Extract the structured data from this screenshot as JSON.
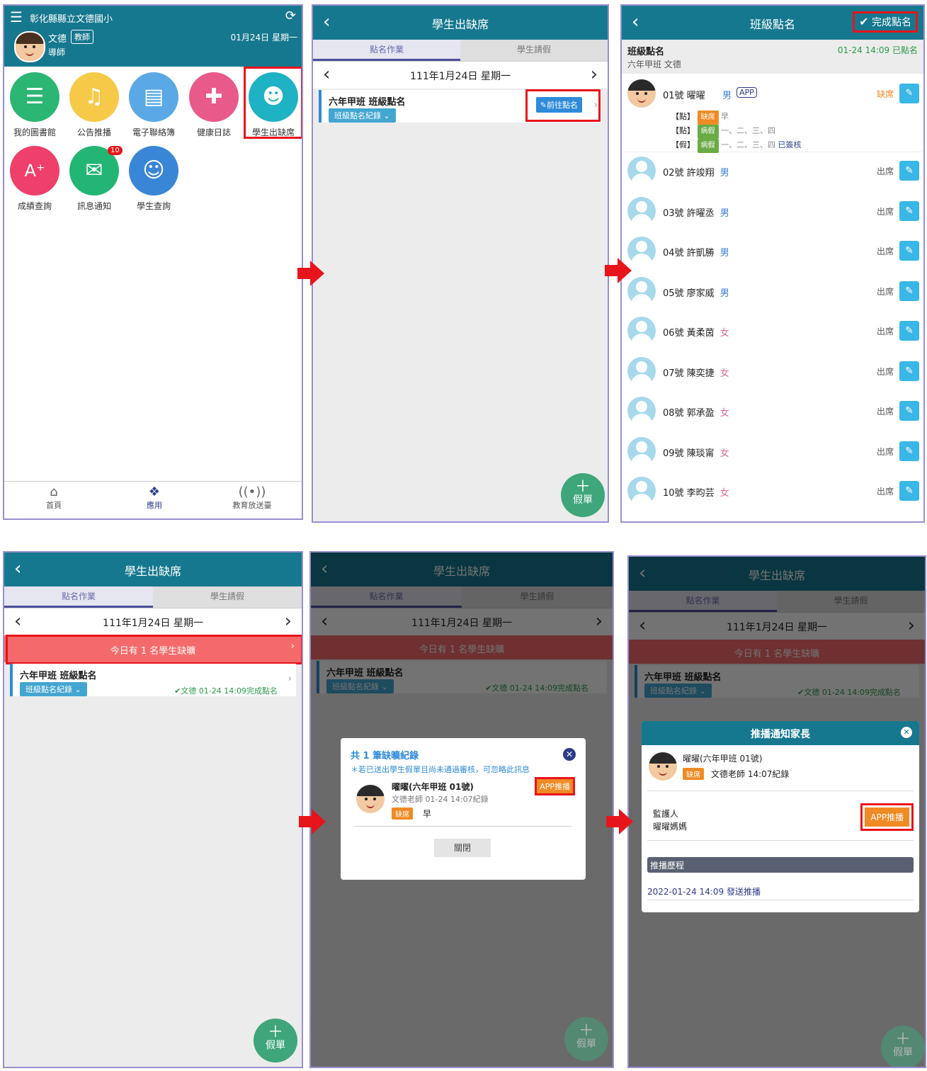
{
  "p1": {
    "school": "彰化縣縣立文德國小",
    "user_name": "文德",
    "role_tag": "教師",
    "role": "導師",
    "date": "01月24日 星期一",
    "apps": [
      {
        "label": "我的圖書館",
        "icon": "library-icon",
        "color": "#2bb673",
        "glyph": "☰"
      },
      {
        "label": "公告推播",
        "icon": "bell-icon",
        "color": "#f7c948",
        "glyph": "🔔"
      },
      {
        "label": "電子聯絡簿",
        "icon": "contact-book-icon",
        "color": "#5aa9e6",
        "glyph": "📒"
      },
      {
        "label": "健康日誌",
        "icon": "medical-kit-icon",
        "color": "#e85a8a",
        "glyph": "✚"
      },
      {
        "label": "學生出缺席",
        "icon": "students-icon",
        "color": "#1fb1c4",
        "glyph": "👥"
      },
      {
        "label": "成績查詢",
        "icon": "grade-icon",
        "color": "#ef3f6b",
        "glyph": "A⁺"
      },
      {
        "label": "訊息通知",
        "icon": "message-icon",
        "color": "#23b573",
        "glyph": "✉"
      },
      {
        "label": "學生查詢",
        "icon": "student-search-icon",
        "color": "#3a86d6",
        "glyph": "👤"
      }
    ],
    "msg_badge": "10",
    "nav": [
      "首頁",
      "應用",
      "教育放送臺"
    ]
  },
  "common": {
    "attendance_title": "學生出缺席",
    "tab_rollcall": "點名作業",
    "tab_leave": "學生請假",
    "date": "111年1月24日 星期一",
    "class_title": "六年甲班 班級點名",
    "record_btn": "班級點名紀錄 ⌄",
    "goto_btn": "前往點名",
    "fab_label": "假單",
    "fab_plus": "＋",
    "absent_banner": "今日有 1 名學生缺曠",
    "done_text": "✔文德 01-24 14:09完成點名"
  },
  "p3": {
    "title": "班級點名",
    "finish_btn": "完成點名",
    "section_title": "班級點名",
    "section_time": "01-24 14:09 已點名",
    "class_teacher": "六年甲班 文德",
    "first": {
      "name": "01號 曜曜",
      "sex": "男",
      "app": "APP",
      "status": "缺席",
      "details": [
        {
          "tag": "【點】",
          "badge": "缺席",
          "badge_color": "#f08a24",
          "text": "早"
        },
        {
          "tag": "【點】",
          "badge": "病假",
          "badge_color": "#6aab45",
          "text": "一、二、三、四"
        },
        {
          "tag": "【假】",
          "badge": "病假",
          "badge_color": "#6aab45",
          "text": "一、二、三、四",
          "extra": "已簽核"
        }
      ]
    },
    "students": [
      {
        "name": "02號 許竣翔",
        "sex": "男",
        "status": "出席"
      },
      {
        "name": "03號 許曜丞",
        "sex": "男",
        "status": "出席"
      },
      {
        "name": "04號 許凱勝",
        "sex": "男",
        "status": "出席"
      },
      {
        "name": "05號 廖家威",
        "sex": "男",
        "status": "出席"
      },
      {
        "name": "06號 黃柔茵",
        "sex": "女",
        "status": "出席"
      },
      {
        "name": "07號 陳奕捷",
        "sex": "女",
        "status": "出席"
      },
      {
        "name": "08號 郭承盈",
        "sex": "女",
        "status": "出席"
      },
      {
        "name": "09號 陳琰甯",
        "sex": "女",
        "status": "出席"
      },
      {
        "name": "10號 李昀芸",
        "sex": "女",
        "status": "出席"
      }
    ]
  },
  "p5": {
    "title": "共 1 筆缺曠紀錄",
    "note": "＊若已送出學生假單且尚未通過審核，可忽略此訊息",
    "student": "曜曜(六年甲班 01號)",
    "recorder": "文德老師 01-24 14:07紀錄",
    "badge": "缺席",
    "period": "早",
    "push_btn": "APP推播",
    "close_btn": "關閉"
  },
  "p6": {
    "title": "推播通知家長",
    "student": "曜曜(六年甲班 01號)",
    "badge": "缺席",
    "recorder": "文德老師 14:07紀錄",
    "guardian_label": "監護人",
    "guardian_name": "曜曜媽媽",
    "push_btn": "APP推播",
    "history_label": "推播歷程",
    "history_item": "2022-01-24 14:09 發送推播"
  }
}
